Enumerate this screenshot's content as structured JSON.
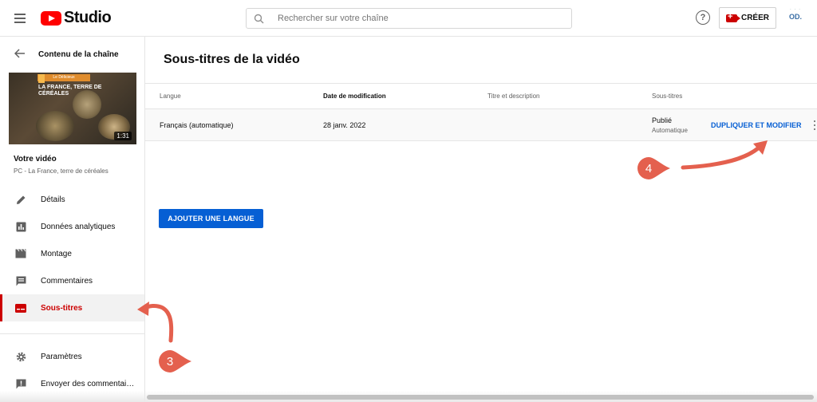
{
  "header": {
    "logo_text": "Studio",
    "search_placeholder": "Rechercher sur votre chaîne",
    "help_label": "?",
    "create_label": "CRÉER",
    "avatar_initials": "OD."
  },
  "sidebar": {
    "back_title": "Contenu de la chaîne",
    "thumbnail": {
      "banner": "Le Délicieux",
      "title": "LA FRANCE, TERRE DE CÉRÉALES",
      "duration": "1:31"
    },
    "video_label": "Votre vidéo",
    "video_subtitle": "PC - La France, terre de céréales",
    "items": [
      {
        "label": "Détails",
        "icon": "pencil-icon"
      },
      {
        "label": "Données analytiques",
        "icon": "analytics-icon"
      },
      {
        "label": "Montage",
        "icon": "clapperboard-icon"
      },
      {
        "label": "Commentaires",
        "icon": "comment-icon"
      },
      {
        "label": "Sous-titres",
        "icon": "subtitles-icon",
        "active": true
      }
    ],
    "bottom_items": [
      {
        "label": "Paramètres",
        "icon": "gear-icon"
      },
      {
        "label": "Envoyer des commentai…",
        "icon": "feedback-icon"
      }
    ]
  },
  "main": {
    "title": "Sous-titres de la vidéo",
    "columns": [
      "Langue",
      "Date de modification",
      "Titre et description",
      "Sous-titres"
    ],
    "rows": [
      {
        "language": "Français (automatique)",
        "date": "28 janv. 2022",
        "title_desc": "",
        "status": "Publié",
        "status_sub": "Automatique",
        "action": "DUPLIQUER ET MODIFIER"
      }
    ],
    "add_language_label": "AJOUTER UNE LANGUE"
  },
  "annotations": {
    "step3": "3",
    "step4": "4",
    "color": "#e4604e"
  },
  "colors": {
    "brand_red": "#ff0000",
    "active_red": "#cc0000",
    "link_blue": "#065fd4"
  }
}
